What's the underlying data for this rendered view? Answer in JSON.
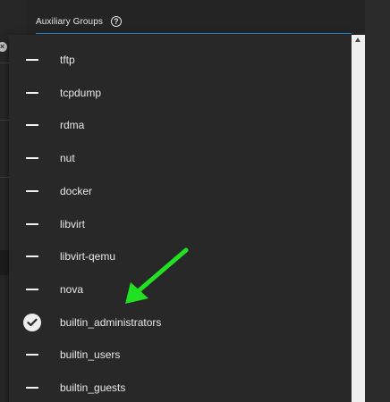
{
  "field": {
    "label": "Auxiliary Groups",
    "help_icon": "help-circle-icon",
    "accent_color": "#1f8ad2"
  },
  "options": [
    {
      "label": "tftp",
      "selected": false
    },
    {
      "label": "tcpdump",
      "selected": false
    },
    {
      "label": "rdma",
      "selected": false
    },
    {
      "label": "nut",
      "selected": false
    },
    {
      "label": "docker",
      "selected": false
    },
    {
      "label": "libvirt",
      "selected": false
    },
    {
      "label": "libvirt-qemu",
      "selected": false
    },
    {
      "label": "nova",
      "selected": false
    },
    {
      "label": "builtin_administrators",
      "selected": true
    },
    {
      "label": "builtin_users",
      "selected": false
    },
    {
      "label": "builtin_guests",
      "selected": false
    }
  ],
  "annotation": {
    "type": "arrow",
    "color": "#22e022",
    "points_to": "builtin_administrators"
  }
}
